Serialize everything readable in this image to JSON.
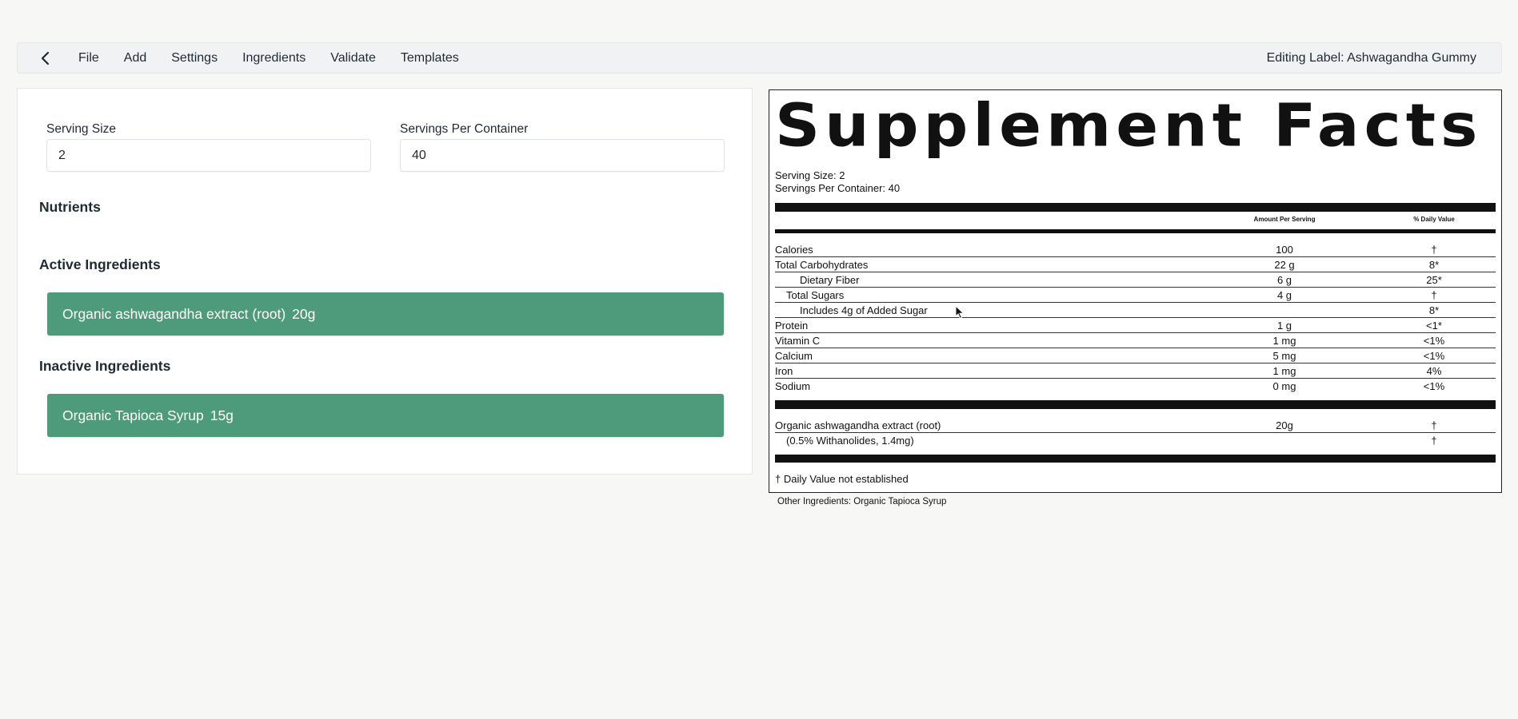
{
  "menubar": {
    "items": [
      "File",
      "Add",
      "Settings",
      "Ingredients",
      "Validate",
      "Templates"
    ],
    "editing_title": "Editing Label: Ashwagandha Gummy"
  },
  "editor": {
    "serving_size_label": "Serving Size",
    "serving_size_value": "2",
    "servings_per_container_label": "Servings Per Container",
    "servings_per_container_value": "40",
    "nutrients_heading": "Nutrients",
    "active_heading": "Active Ingredients",
    "inactive_heading": "Inactive Ingredients",
    "active_ingredients": [
      {
        "name": "Organic ashwagandha extract (root)",
        "qty": "20g"
      }
    ],
    "inactive_ingredients": [
      {
        "name": "Organic Tapioca Syrup",
        "qty": "15g"
      }
    ],
    "ingredient_bar_color": "#4d9b7b"
  },
  "label": {
    "title": "Supplement Facts",
    "serving_size": "Serving Size: 2",
    "servings_per_container": "Servings Per Container: 40",
    "col_amount": "Amount Per Serving",
    "col_dv": "% Daily Value",
    "nutrients": [
      {
        "name": "Calories",
        "amount": "100",
        "dv": "†",
        "indent": 0
      },
      {
        "name": "Total Carbohydrates",
        "amount": "22 g",
        "dv": "8*",
        "indent": 0
      },
      {
        "name": "Dietary Fiber",
        "amount": "6 g",
        "dv": "25*",
        "indent": 2
      },
      {
        "name": "Total Sugars",
        "amount": "4 g",
        "dv": "†",
        "indent": 1
      },
      {
        "name": "Includes 4g of Added Sugar",
        "amount": "",
        "dv": "8*",
        "indent": 2
      },
      {
        "name": "Protein",
        "amount": "1 g",
        "dv": "<1*",
        "indent": 0
      },
      {
        "name": "Vitamin C",
        "amount": "1 mg",
        "dv": "<1%",
        "indent": 0
      },
      {
        "name": "Calcium",
        "amount": "5 mg",
        "dv": "<1%",
        "indent": 0
      },
      {
        "name": "Iron",
        "amount": "1 mg",
        "dv": "4%",
        "indent": 0
      },
      {
        "name": "Sodium",
        "amount": "0 mg",
        "dv": "<1%",
        "indent": 0
      }
    ],
    "actives": [
      {
        "name": "Organic ashwagandha extract (root)",
        "amount": "20g",
        "dv": "†",
        "indent": 0
      },
      {
        "name": "(0.5% Withanolides, 1.4mg)",
        "amount": "",
        "dv": "†",
        "indent": 1
      }
    ],
    "footnote": "† Daily Value not established",
    "other_ingredients": "Other Ingredients: Organic Tapioca Syrup"
  }
}
